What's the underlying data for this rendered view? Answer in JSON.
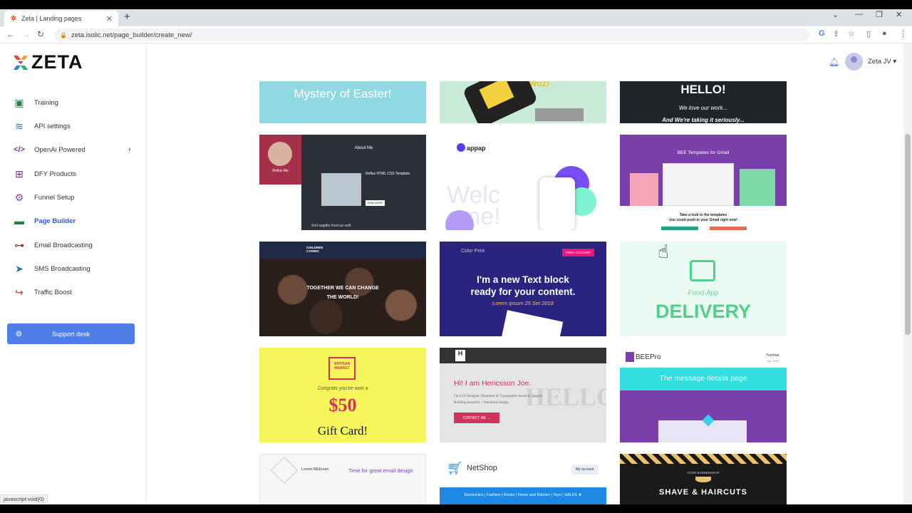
{
  "browser": {
    "tab_title": "Zeta | Landing pages",
    "url": "zeta.isolic.net/page_builder/create_new/",
    "status_text": "javascript:void(0)"
  },
  "app": {
    "logo_text": "ZETA",
    "user_name": "Zeta JV",
    "accent_color": "#4e7fe6"
  },
  "sidebar": {
    "items": [
      {
        "label": "Training",
        "icon": "training-icon"
      },
      {
        "label": "API settings",
        "icon": "wifi-icon"
      },
      {
        "label": "OpenAi Powered",
        "icon": "code-icon"
      },
      {
        "label": "DFY Products",
        "icon": "gift-icon"
      },
      {
        "label": "Funnel Setup",
        "icon": "gear-icon"
      },
      {
        "label": "Page Builder",
        "icon": "chat-icon"
      },
      {
        "label": "Email Broadcasting",
        "icon": "sitemap-icon"
      },
      {
        "label": "SMS Broadcasting",
        "icon": "send-icon"
      },
      {
        "label": "Traffic Boost",
        "icon": "share-icon"
      }
    ],
    "support_label": "Support desk"
  },
  "templates": {
    "t1": {
      "line1": "Mystery of Easter!"
    },
    "t2": {
      "line1": "Steve Wuz!"
    },
    "t3": {
      "line1": "HELLO!",
      "line2": "We love our work...",
      "line3": "And We're taking it seriously..."
    },
    "t4": {
      "name": "Reflux Me",
      "heading": "About Me",
      "sub": "Reflux HTML CSS Template",
      "footer": "Sed sagittis rhoncus velit",
      "btn": "READ MORE"
    },
    "t5": {
      "brand": "appap",
      "bg_word": "Welc ome!"
    },
    "t6": {
      "line1": "BEE Templates for Gmail",
      "line2": "Take a look to the templates",
      "line3": "you could push in your Gmail right now!"
    },
    "t7": {
      "brand": "CHILDREN CARING",
      "line1": "TOGETHER WE CAN CHANGE",
      "line2": "THE WORLD!"
    },
    "t8": {
      "brand": "Color Print",
      "btn": "FREE ACCOUNT",
      "line1": "I'm a new Text block",
      "line2": "ready for your content.",
      "line3": "Lorem ipsum 25 Set 2018"
    },
    "t9": {
      "line1": "Food App",
      "line2": "DELIVERY"
    },
    "t10": {
      "brand": "ARTISAN MARKET",
      "line1": "Congrats you've won a",
      "amount": "$50",
      "line2": "Gift Card!"
    },
    "t11": {
      "logo": "H",
      "line1": "Hi! I am Hericsson Joe.",
      "line2": "I'm a UI Designer, Illustrator & Typographer based in Toronto",
      "line3": "Building beautiful + functional design.",
      "btn": "CONTACT ME →",
      "bg_word": "HELLO"
    },
    "t12": {
      "brand": "BEEPro",
      "tag": "Tutorial",
      "date": "July 2019",
      "line1": "The message details page"
    },
    "t13": {
      "brand": "Lorem BEEsum",
      "line1": "Time for great email design"
    },
    "t14": {
      "brand": "NetShop",
      "btn": "My account",
      "nav": "Electronics | Fashion | Books | Home and Kitchen | Toys | SALES ★"
    },
    "t15": {
      "line0": "YOUR BARBERSHOP",
      "line1": "SHAVE & HAIRCUTS"
    }
  }
}
